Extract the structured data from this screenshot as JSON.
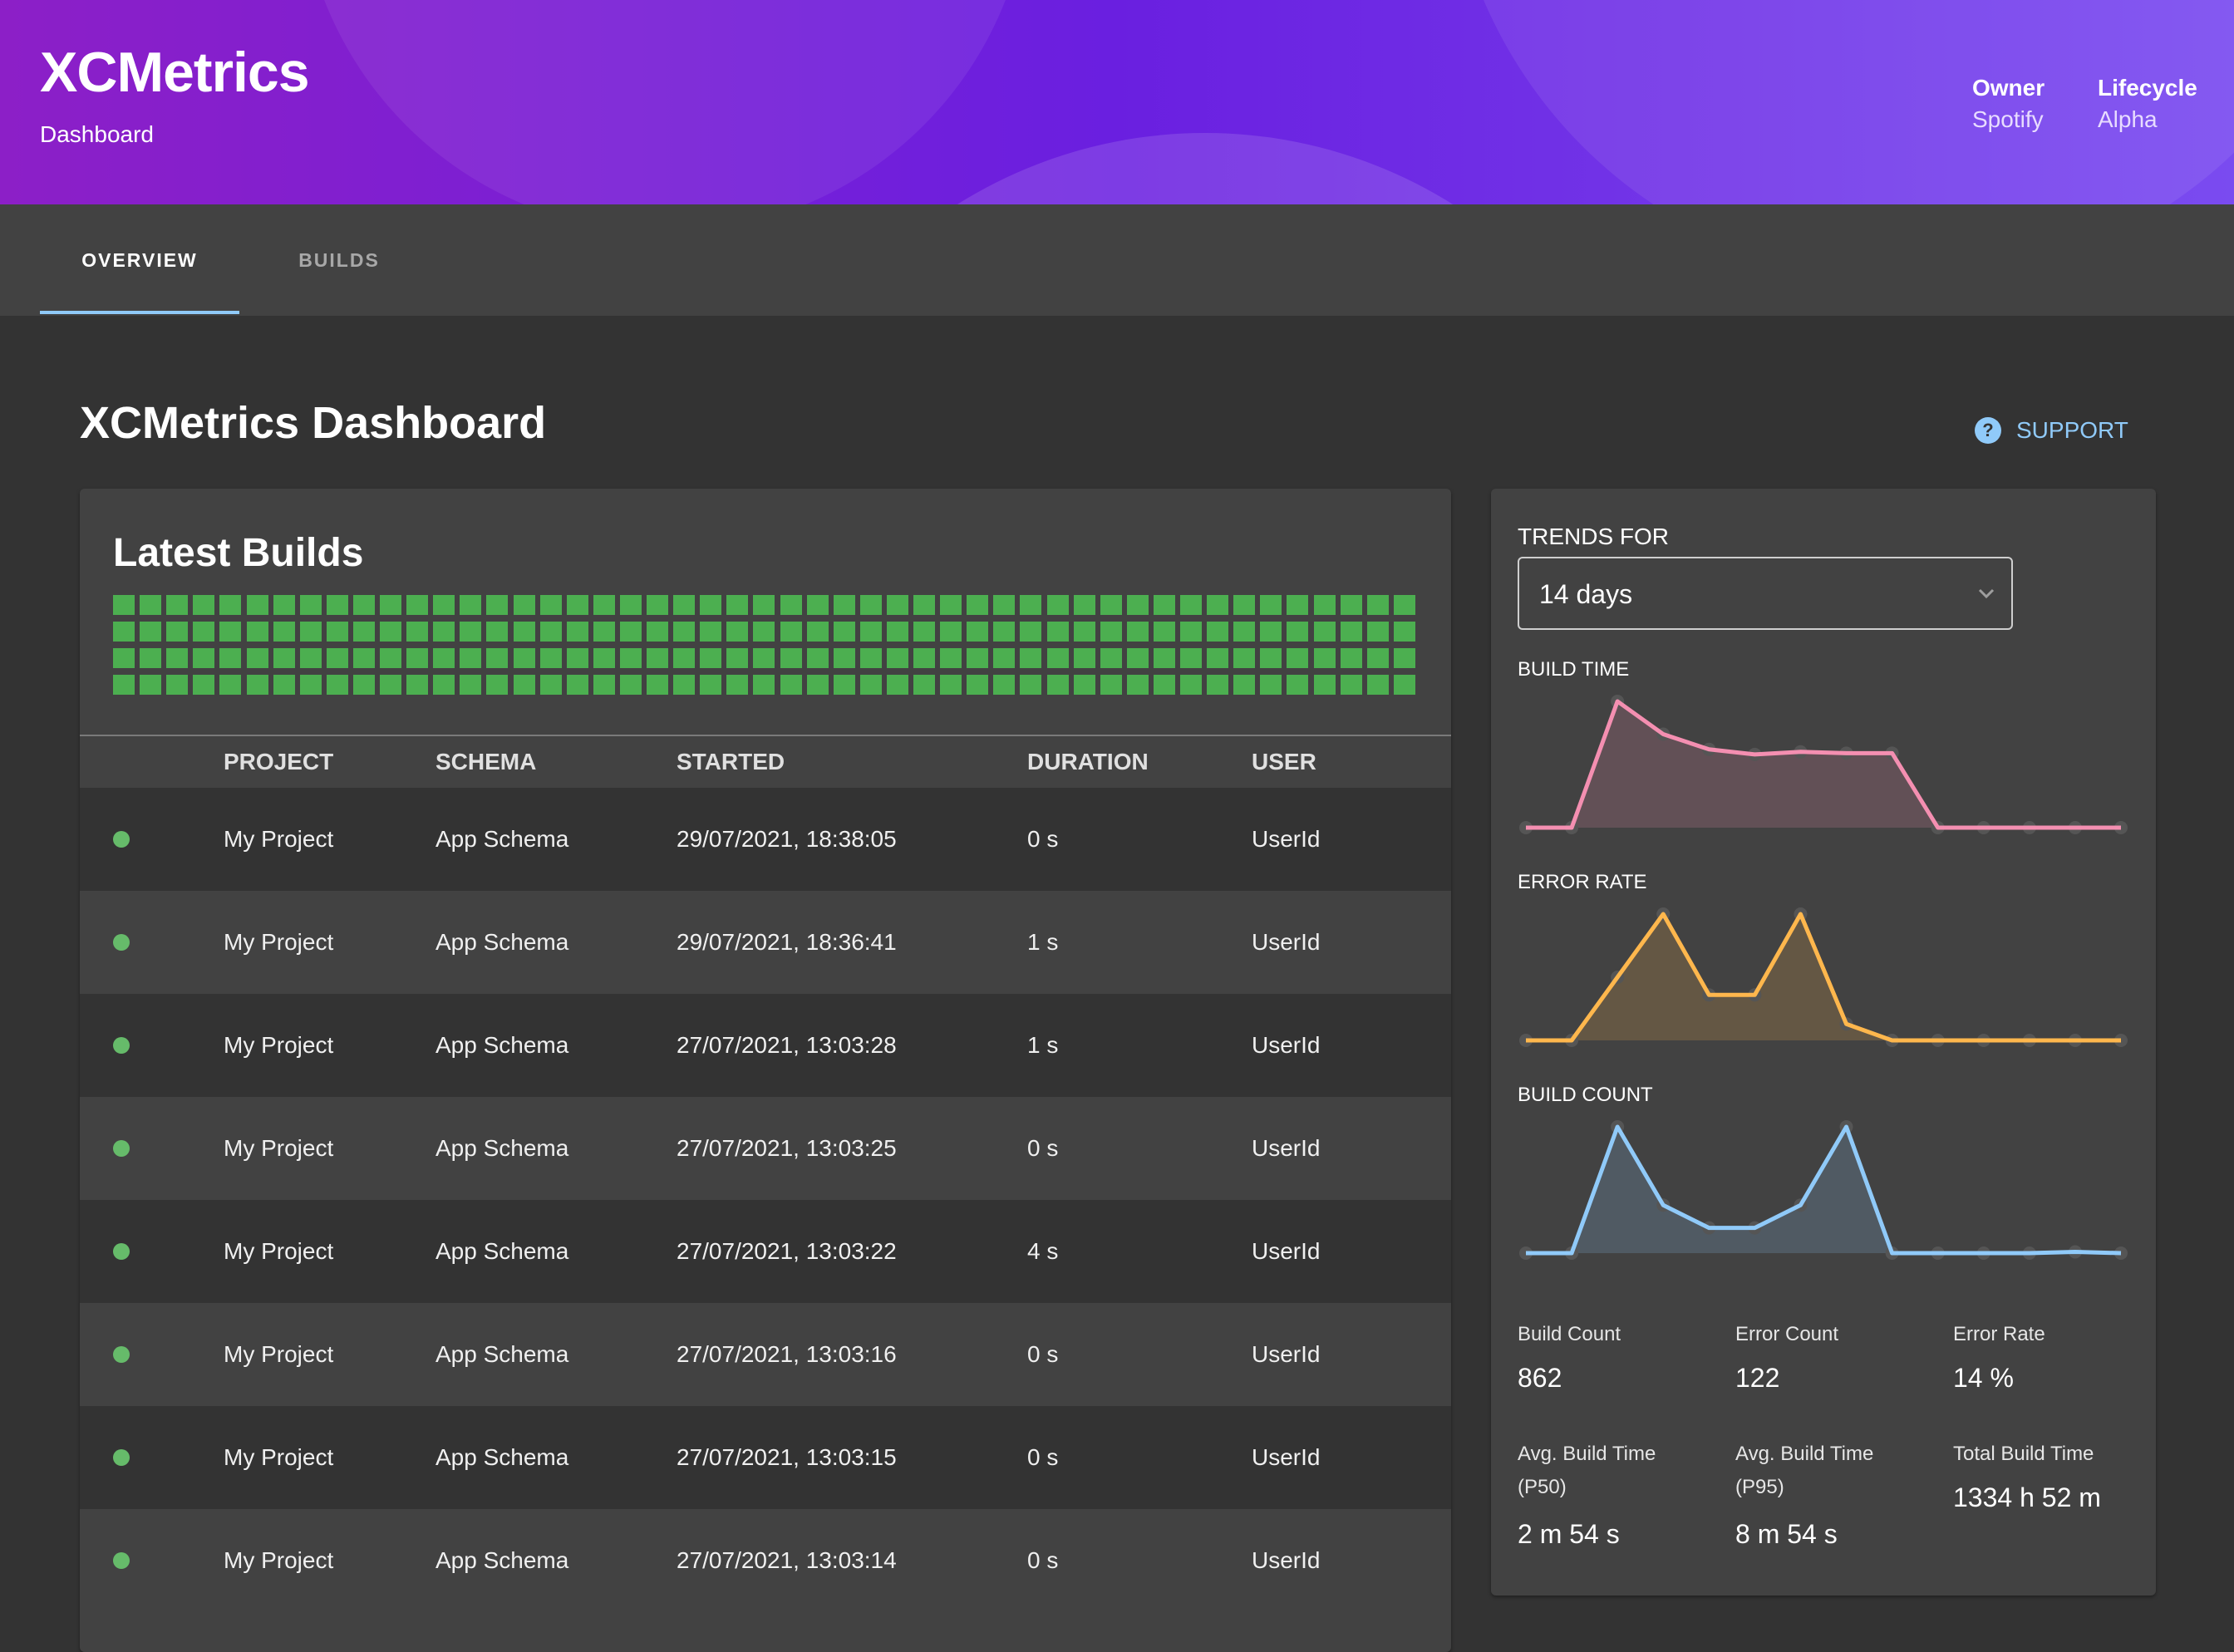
{
  "header": {
    "title": "XCMetrics",
    "subtitle": "Dashboard",
    "owner_label": "Owner",
    "owner_value": "Spotify",
    "lifecycle_label": "Lifecycle",
    "lifecycle_value": "Alpha"
  },
  "tabs": [
    {
      "label": "OVERVIEW",
      "active": true
    },
    {
      "label": "BUILDS",
      "active": false
    }
  ],
  "page": {
    "title": "XCMetrics Dashboard",
    "support_label": "SUPPORT"
  },
  "latest_builds": {
    "title": "Latest Builds",
    "status_squares": {
      "count": 196,
      "status": "succeeded",
      "color": "#4caf50"
    },
    "columns": [
      "PROJECT",
      "SCHEMA",
      "STARTED",
      "DURATION",
      "USER"
    ],
    "rows": [
      {
        "status": "succeeded",
        "project": "My Project",
        "schema": "App Schema",
        "started": "29/07/2021, 18:38:05",
        "duration": "0 s",
        "user": "UserId"
      },
      {
        "status": "succeeded",
        "project": "My Project",
        "schema": "App Schema",
        "started": "29/07/2021, 18:36:41",
        "duration": "1 s",
        "user": "UserId"
      },
      {
        "status": "succeeded",
        "project": "My Project",
        "schema": "App Schema",
        "started": "27/07/2021, 13:03:28",
        "duration": "1 s",
        "user": "UserId"
      },
      {
        "status": "succeeded",
        "project": "My Project",
        "schema": "App Schema",
        "started": "27/07/2021, 13:03:25",
        "duration": "0 s",
        "user": "UserId"
      },
      {
        "status": "succeeded",
        "project": "My Project",
        "schema": "App Schema",
        "started": "27/07/2021, 13:03:22",
        "duration": "4 s",
        "user": "UserId"
      },
      {
        "status": "succeeded",
        "project": "My Project",
        "schema": "App Schema",
        "started": "27/07/2021, 13:03:16",
        "duration": "0 s",
        "user": "UserId"
      },
      {
        "status": "succeeded",
        "project": "My Project",
        "schema": "App Schema",
        "started": "27/07/2021, 13:03:15",
        "duration": "0 s",
        "user": "UserId"
      },
      {
        "status": "succeeded",
        "project": "My Project",
        "schema": "App Schema",
        "started": "27/07/2021, 13:03:14",
        "duration": "0 s",
        "user": "UserId"
      }
    ]
  },
  "trends": {
    "label": "TRENDS FOR",
    "period_selected": "14 days",
    "charts": [
      {
        "title": "BUILD TIME",
        "color": "#f48fb1",
        "values": [
          0,
          0,
          1.0,
          0.74,
          0.62,
          0.58,
          0.6,
          0.59,
          0.59,
          0,
          0,
          0,
          0,
          0
        ]
      },
      {
        "title": "ERROR RATE",
        "color": "#ffb74d",
        "values": [
          0,
          0,
          0.5,
          1.0,
          0.36,
          0.36,
          1.0,
          0.13,
          0,
          0,
          0,
          0,
          0,
          0
        ]
      },
      {
        "title": "BUILD COUNT",
        "color": "#90caf9",
        "values": [
          0,
          0,
          1.0,
          0.38,
          0.2,
          0.2,
          0.38,
          1.0,
          0,
          0,
          0,
          0,
          0.01,
          0
        ]
      }
    ],
    "stats": [
      {
        "label": "Build Count",
        "value": "862"
      },
      {
        "label": "Error Count",
        "value": "122"
      },
      {
        "label": "Error Rate",
        "value": "14 %"
      },
      {
        "label": "Avg. Build Time (P50)",
        "value": "2 m 54 s"
      },
      {
        "label": "Avg. Build Time (P95)",
        "value": "8 m 54 s"
      },
      {
        "label": "Total Build Time",
        "value": "1334 h 52 m"
      }
    ]
  },
  "icons": {
    "support": "help-circle-icon",
    "select_arrow": "chevron-down-icon",
    "build_status": "status-dot-icon"
  }
}
